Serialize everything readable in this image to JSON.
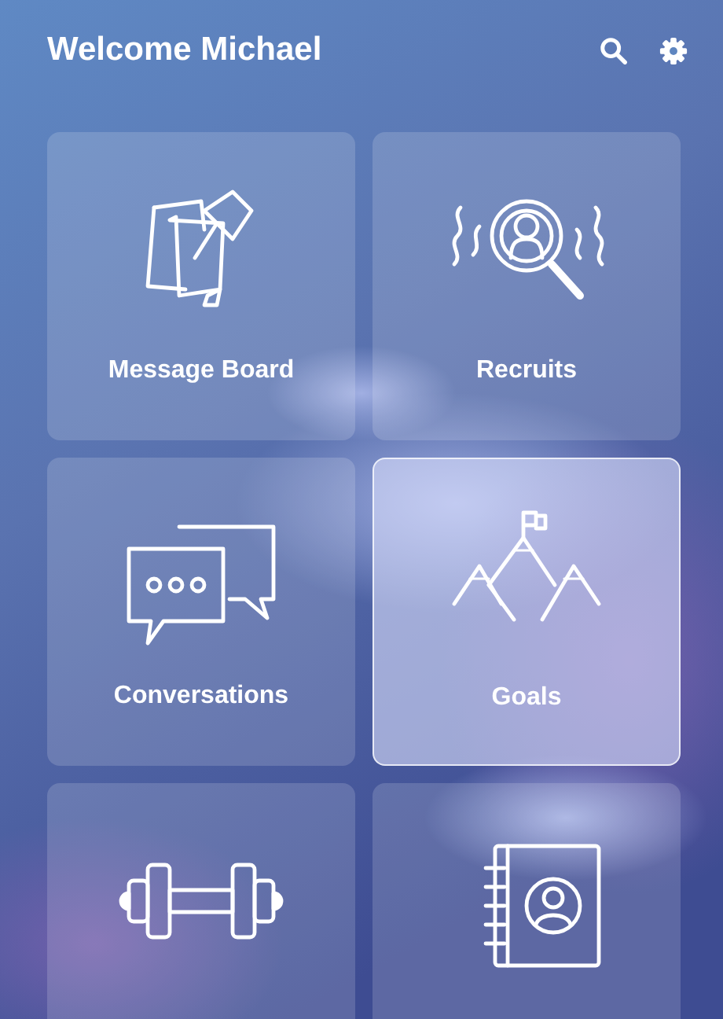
{
  "header": {
    "title": "Welcome Michael"
  },
  "tiles": [
    {
      "kind": "message-board",
      "label": "Message Board",
      "selected": false
    },
    {
      "kind": "recruits",
      "label": "Recruits",
      "selected": false
    },
    {
      "kind": "conversations",
      "label": "Conversations",
      "selected": false
    },
    {
      "kind": "goals",
      "label": "Goals",
      "selected": true
    },
    {
      "kind": "workout",
      "selected": false
    },
    {
      "kind": "contacts",
      "selected": false
    }
  ]
}
